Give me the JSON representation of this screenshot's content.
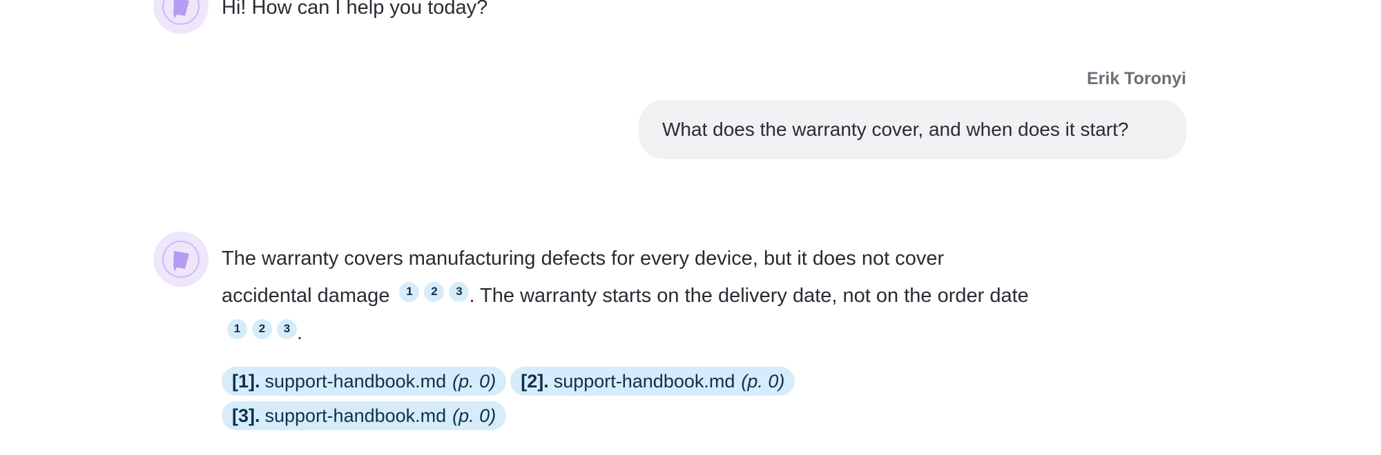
{
  "greeting": {
    "text": "Hi! How can I help you today?"
  },
  "user_message": {
    "author": "Erik Toronyi",
    "text": "What does the warranty cover, and when does it start?"
  },
  "answer": {
    "line1": "The warranty covers manufacturing defects for every device, but it does not cover",
    "part1": "accidental damage",
    "part2": ". The warranty starts on the delivery date, not on the order date",
    "part3": ".",
    "citations_group_1": [
      "1",
      "2",
      "3"
    ],
    "citations_group_2": [
      "1",
      "2",
      "3"
    ]
  },
  "sources": [
    {
      "num": "[1].",
      "file": "support-handbook.md",
      "page": "(p. 0)"
    },
    {
      "num": "[2].",
      "file": "support-handbook.md",
      "page": "(p. 0)"
    },
    {
      "num": "[3].",
      "file": "support-handbook.md",
      "page": "(p. 0)"
    }
  ],
  "colors": {
    "avatar_bg": "#eee6fb",
    "avatar_icon": "#b59cf2",
    "user_bubble": "#f0f1f3",
    "citation_bg": "#d6ecfb",
    "citation_text": "#10304a"
  }
}
